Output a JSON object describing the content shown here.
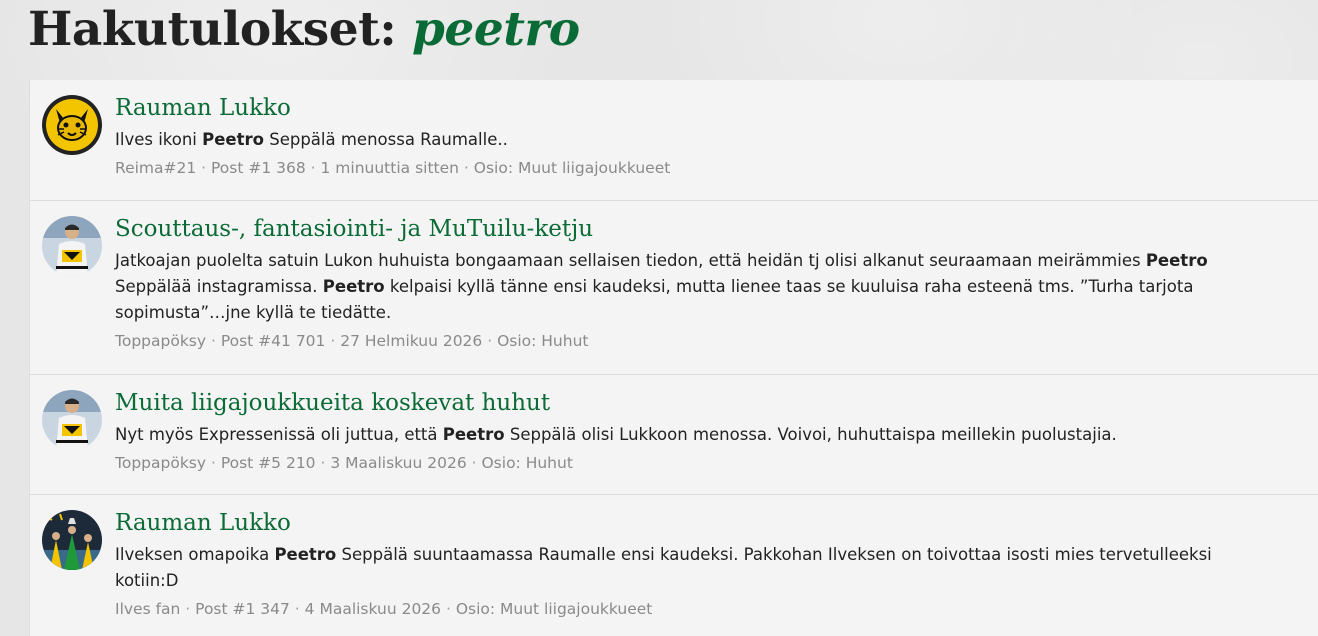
{
  "heading": {
    "prefix": "Hakutulokset:",
    "query": "peetro"
  },
  "results": [
    {
      "title": "Rauman Lukko",
      "avatar": "lynx-logo-avatar",
      "snippet": [
        {
          "t": "Ilves ikoni "
        },
        {
          "t": "Peetro",
          "b": true
        },
        {
          "t": " Seppälä menossa Raumalle.."
        }
      ],
      "author": "Reima#21",
      "post": "Post #1 368",
      "time": "1 minuuttia sitten",
      "section": "Osio: Muut liigajoukkueet"
    },
    {
      "title": "Scouttaus-, fantasiointi- ja MuTuilu-ketju",
      "avatar": "hockey-player-avatar",
      "snippet": [
        {
          "t": "Jatkoajan puolelta satuin Lukon huhuista bongaamaan sellaisen tiedon, että heidän tj olisi alkanut seuraamaan meirämmies "
        },
        {
          "t": "Peetro",
          "b": true
        },
        {
          "t": "\nSeppälää instagramissa. "
        },
        {
          "t": "Peetro",
          "b": true
        },
        {
          "t": " kelpaisi kyllä tänne ensi kaudeksi, mutta lienee taas se kuuluisa raha esteenä tms. ”Turha tarjota\nsopimusta”…jne kyllä te tiedätte."
        }
      ],
      "author": "Toppapöksy",
      "post": "Post #41 701",
      "time": "27 Helmikuu 2026",
      "section": "Osio: Huhut"
    },
    {
      "title": "Muita liigajoukkueita koskevat huhut",
      "avatar": "hockey-player-avatar",
      "snippet": [
        {
          "t": "Nyt myös Expressenissä oli juttua, että "
        },
        {
          "t": "Peetro",
          "b": true
        },
        {
          "t": " Seppälä olisi Lukkoon menossa. Voivoi, huhuttaispa meillekin puolustajia."
        }
      ],
      "author": "Toppapöksy",
      "post": "Post #5 210",
      "time": "3 Maaliskuu 2026",
      "section": "Osio: Huhut"
    },
    {
      "title": "Rauman Lukko",
      "avatar": "team-celebration-avatar",
      "snippet": [
        {
          "t": "Ilveksen omapoika "
        },
        {
          "t": "Peetro",
          "b": true
        },
        {
          "t": " Seppälä suuntaamassa Raumalle ensi kaudeksi. Pakkohan Ilveksen on toivottaa isosti mies tervetulleeksi\nkotiin:D"
        }
      ],
      "author": "Ilves fan",
      "post": "Post #1 347",
      "time": "4 Maaliskuu 2026",
      "section": "Osio: Muut liigajoukkueet"
    }
  ],
  "meta_separator": " · ",
  "colors": {
    "title_green": "#0b6b36",
    "text": "#222222",
    "meta": "#8a8a8a"
  }
}
